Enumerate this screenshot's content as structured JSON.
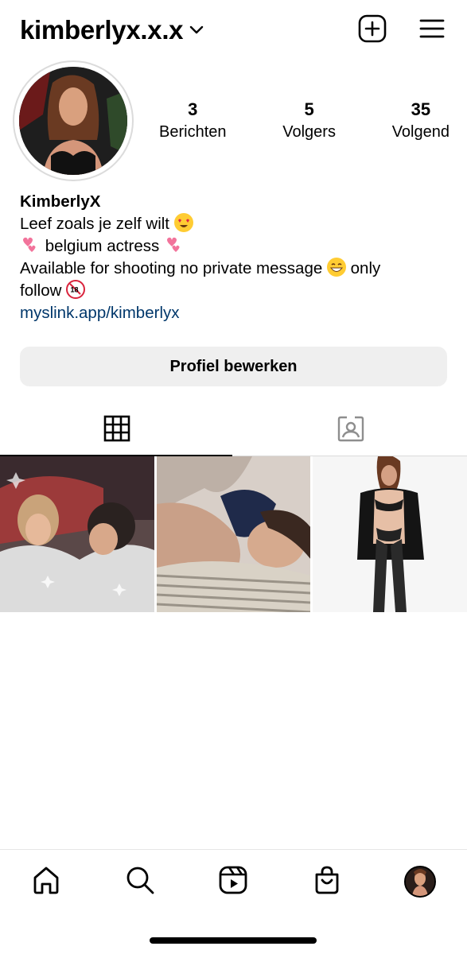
{
  "header": {
    "username": "kimberlyx.x.x",
    "icons": {
      "dropdown": "chevron-down-icon",
      "create": "plus-square-icon",
      "menu": "hamburger-menu-icon"
    }
  },
  "profile": {
    "stats": [
      {
        "count": "3",
        "label": "Berichten"
      },
      {
        "count": "5",
        "label": "Volgers"
      },
      {
        "count": "35",
        "label": "Volgend"
      }
    ]
  },
  "bio": {
    "name": "KimberlyX",
    "line1": "Leef zoals je zelf wilt",
    "line2": "belgium actress",
    "line3a": "Available for shooting no private message",
    "line3b": "only",
    "line4": "follow",
    "link": "myslink.app/kimberlyx"
  },
  "edit_button": {
    "label": "Profiel bewerken"
  },
  "tabs": [
    {
      "name": "posts",
      "icon": "grid-icon",
      "active": true
    },
    {
      "name": "tagged",
      "icon": "tagged-person-icon",
      "active": false
    }
  ],
  "posts": [
    {
      "id": "post-1"
    },
    {
      "id": "post-2"
    },
    {
      "id": "post-3"
    }
  ],
  "bottom_nav": [
    {
      "icon": "home-icon"
    },
    {
      "icon": "search-icon"
    },
    {
      "icon": "reels-icon"
    },
    {
      "icon": "shop-bag-icon"
    },
    {
      "icon": "profile-avatar"
    }
  ],
  "colors": {
    "link": "#00376b",
    "button_bg": "#efefef",
    "divider": "#dbdbdb"
  }
}
